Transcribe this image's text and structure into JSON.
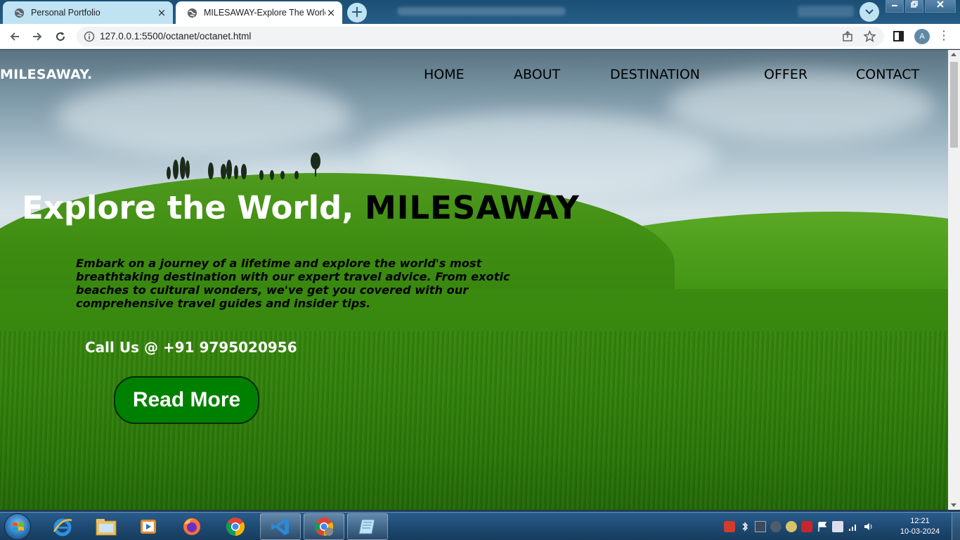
{
  "browser": {
    "tabs": [
      {
        "title": "Personal Portfolio",
        "active": false,
        "icon": "globe-icon"
      },
      {
        "title": "MILESAWAY-Explore The World",
        "active": true,
        "icon": "globe-icon"
      }
    ],
    "url": "127.0.0.1:5500/octanet/octanet.html",
    "profile_initial": "A",
    "tab_close_glyph": "×",
    "new_tab_glyph": "+"
  },
  "page": {
    "logo": "MILESAWAY.",
    "nav": [
      "HOME",
      "ABOUT",
      "DESTINATION",
      "OFFER",
      "CONTACT"
    ],
    "hero_title_prefix": "Explore the World, ",
    "hero_title_accent": "MILESAWAY",
    "hero_description": "Embark on a journey of a lifetime and explore the world's most breathtaking destination with our expert travel advice. From exotic beaches to cultural wonders, we've get you covered with our comprehensive travel guides and insider tips.",
    "phone": "Call Us @ +91 9795020956",
    "cta_label": "Read More"
  },
  "taskbar": {
    "apps": [
      "internet-explorer-icon",
      "file-explorer-icon",
      "media-player-icon",
      "firefox-icon",
      "chrome-icon",
      "vscode-icon",
      "chrome-active-icon",
      "notepad-icon"
    ],
    "time": "12:21",
    "date": "10-03-2024"
  },
  "colors": {
    "tabstrip": "#1c4f74",
    "cta_bg": "#008000",
    "logo": "#ffffff",
    "nav": "#000000"
  }
}
